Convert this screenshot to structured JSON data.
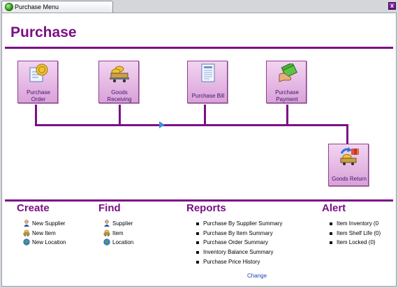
{
  "window": {
    "tab_title": "Purchase Menu",
    "close_glyph": "x",
    "accent": "#7b0f86"
  },
  "header": {
    "title": "Purchase"
  },
  "flow": {
    "tiles": [
      {
        "line1": "Purchase",
        "line2": "Order",
        "icon": "coin-document-icon"
      },
      {
        "line1": "Goods",
        "line2": "Receiving",
        "icon": "cart-coins-icon"
      },
      {
        "line1": "Purchase Bill",
        "line2": "",
        "icon": "bill-document-icon"
      },
      {
        "line1": "Purchase",
        "line2": "Payment",
        "icon": "cash-hand-icon"
      },
      {
        "line1": "Goods Return",
        "line2": "",
        "icon": "return-cart-icon"
      }
    ]
  },
  "sections": {
    "create": {
      "title": "Create",
      "items": [
        "New Supplier",
        "New Item",
        "New Location"
      ]
    },
    "find": {
      "title": "Find",
      "items": [
        "Supplier",
        "Item",
        "Location"
      ]
    },
    "reports": {
      "title": "Reports",
      "items": [
        "Purchase By Supplier Summary",
        "Purchase By Item Summary",
        "Purchase Order Summary",
        "Inventory Balance Summary",
        "Purchase Price History"
      ]
    },
    "alert": {
      "title": "Alert",
      "items": [
        "Item Inventory (0",
        "Item Shelf Life (0)",
        "Item Locked (0)"
      ]
    }
  },
  "footer": {
    "change_label": "Change"
  }
}
